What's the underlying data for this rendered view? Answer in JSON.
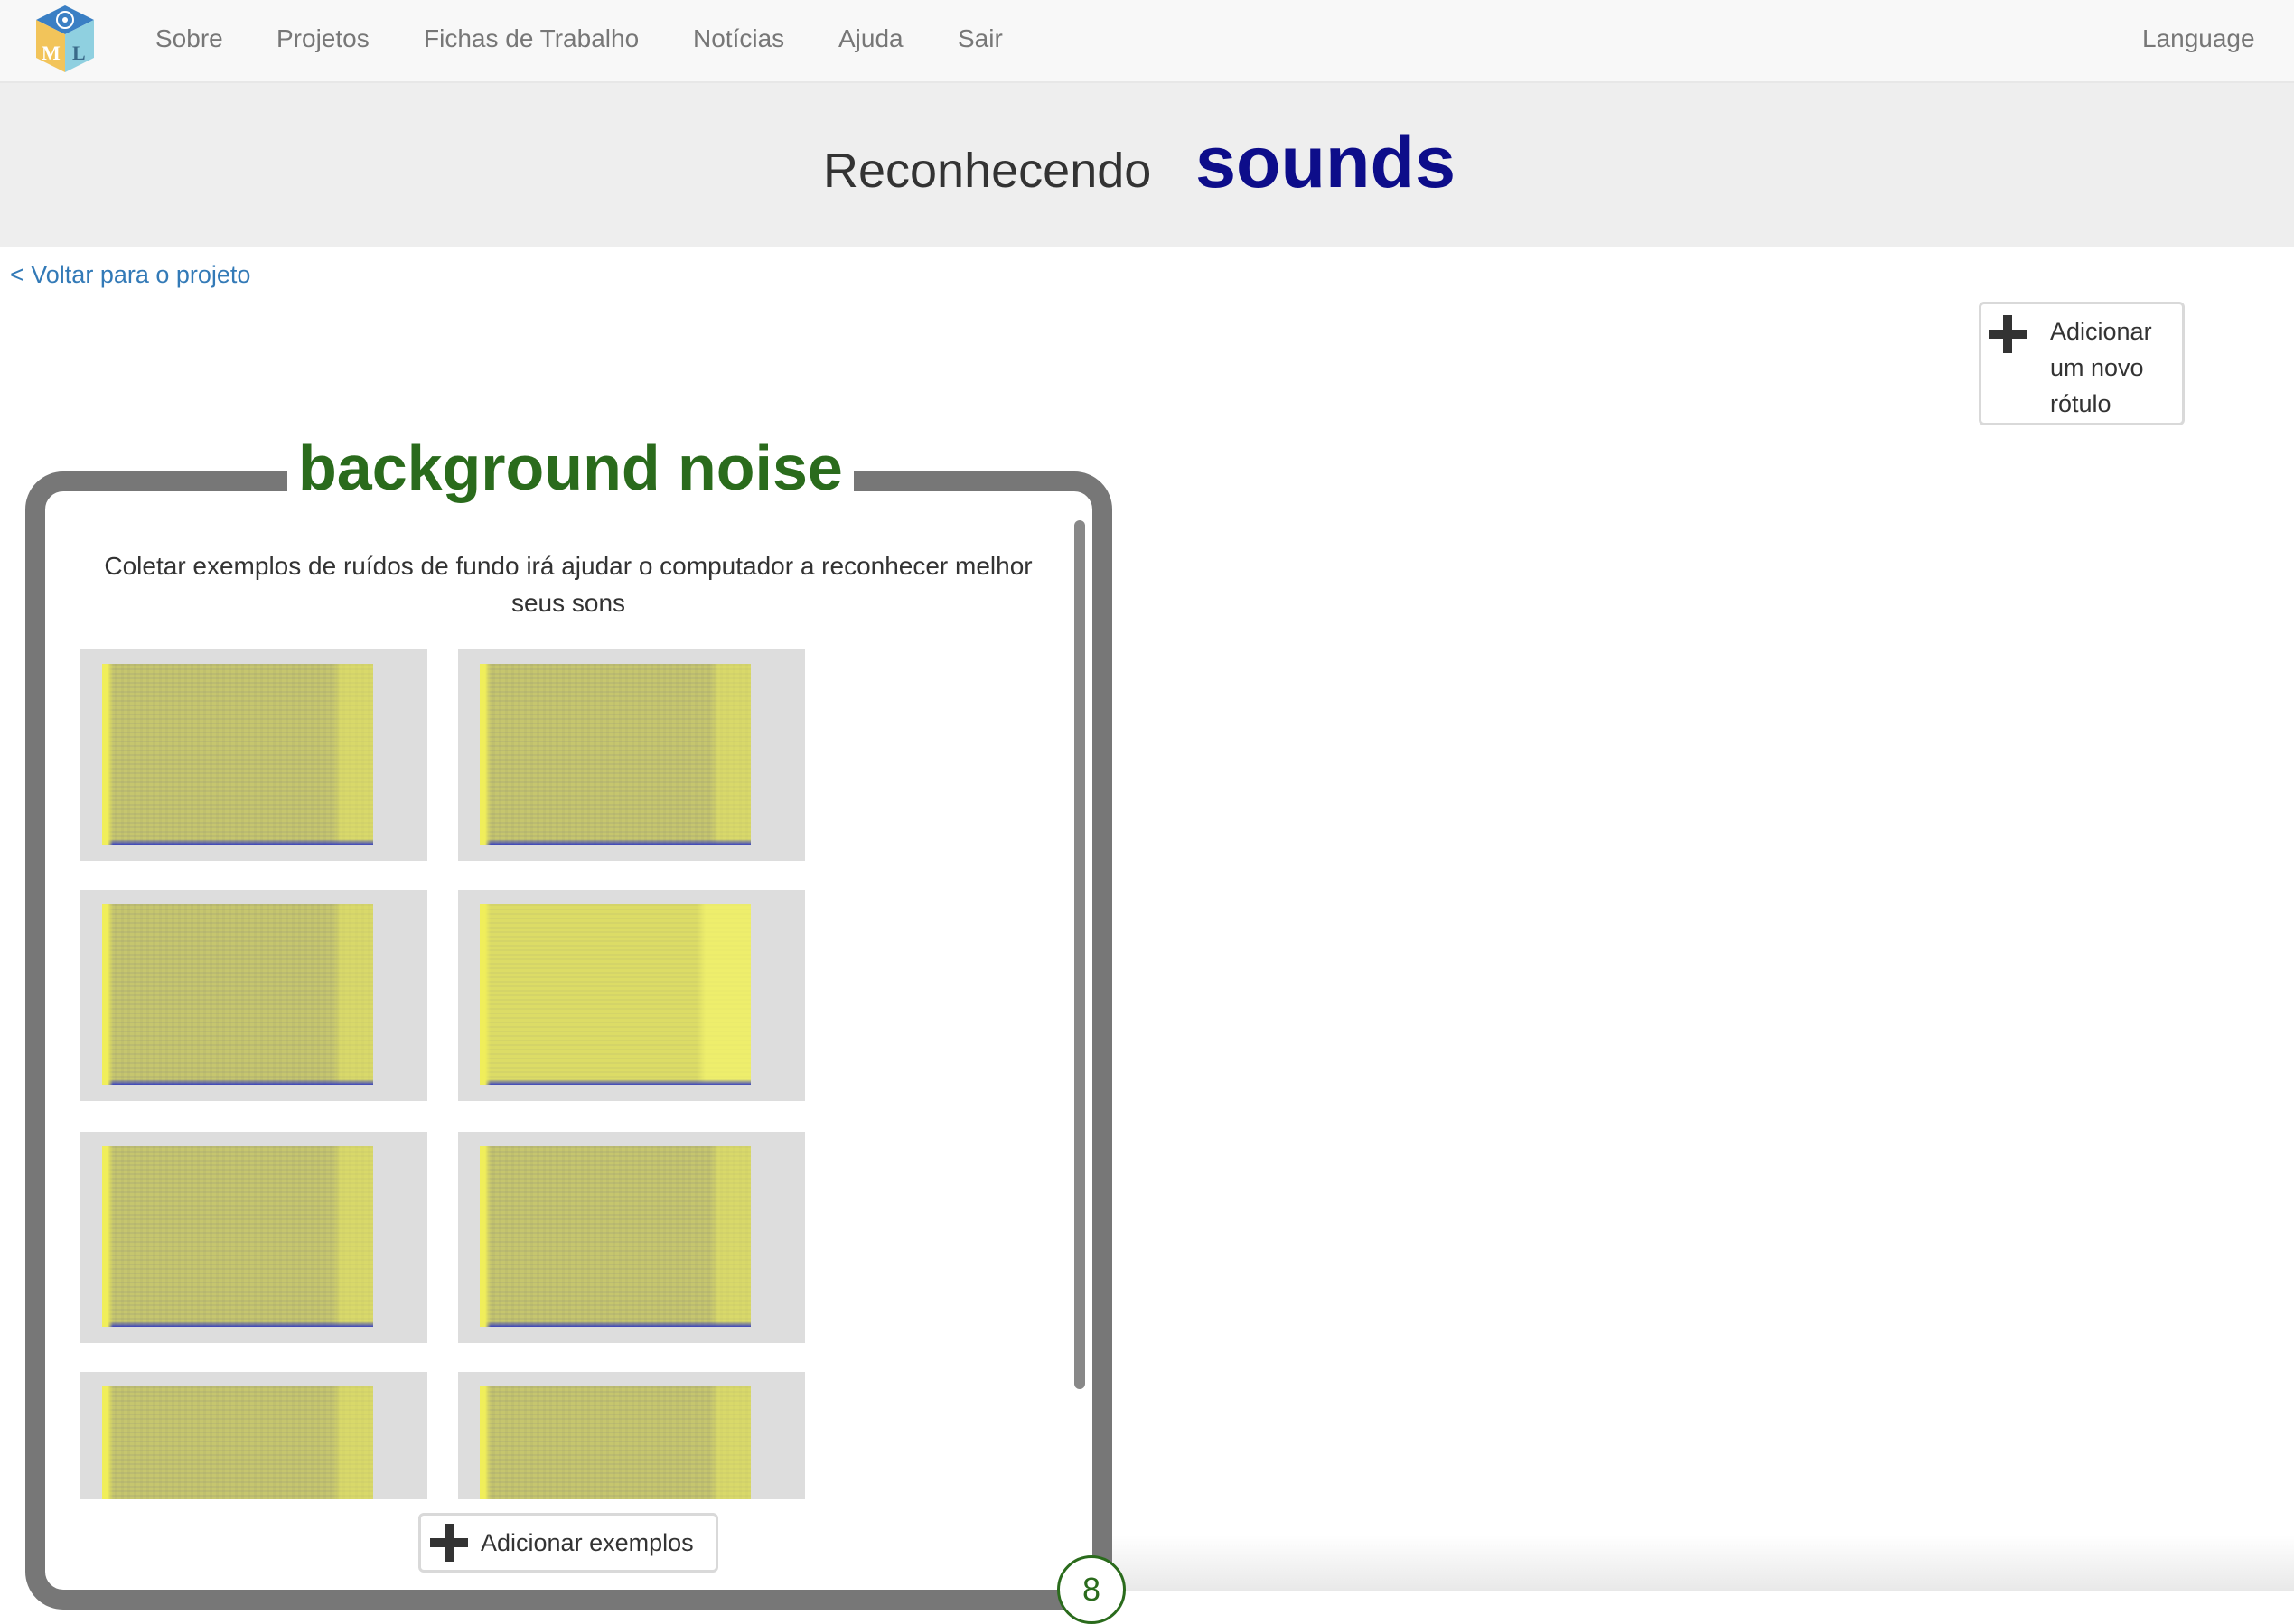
{
  "navbar": {
    "items": [
      {
        "label": "Sobre"
      },
      {
        "label": "Projetos"
      },
      {
        "label": "Fichas de Trabalho"
      },
      {
        "label": "Notícias"
      },
      {
        "label": "Ajuda"
      },
      {
        "label": "Sair"
      }
    ],
    "language_label": "Language",
    "logo_icon": "ml-cube-logo-icon"
  },
  "header": {
    "prefix": "Reconhecendo",
    "project_name": "sounds"
  },
  "back_link": "< Voltar para o projeto",
  "add_label_button": {
    "label": "Adicionar um novo rótulo",
    "icon": "plus-icon"
  },
  "label_card": {
    "title": "background noise",
    "description": "Coletar exemplos de ruídos de fundo irá ajudar o computador a reconhecer melhor seus sons",
    "example_count": "8",
    "add_examples_label": "Adicionar exemplos",
    "examples": [
      {
        "type": "spectrogram"
      },
      {
        "type": "spectrogram"
      },
      {
        "type": "spectrogram"
      },
      {
        "type": "spectrogram"
      },
      {
        "type": "spectrogram"
      },
      {
        "type": "spectrogram"
      },
      {
        "type": "spectrogram"
      },
      {
        "type": "spectrogram"
      }
    ]
  },
  "colors": {
    "project_name": "#0d0d8a",
    "label_title": "#2a6b1c",
    "link": "#337ab7",
    "card_border": "#777777"
  }
}
